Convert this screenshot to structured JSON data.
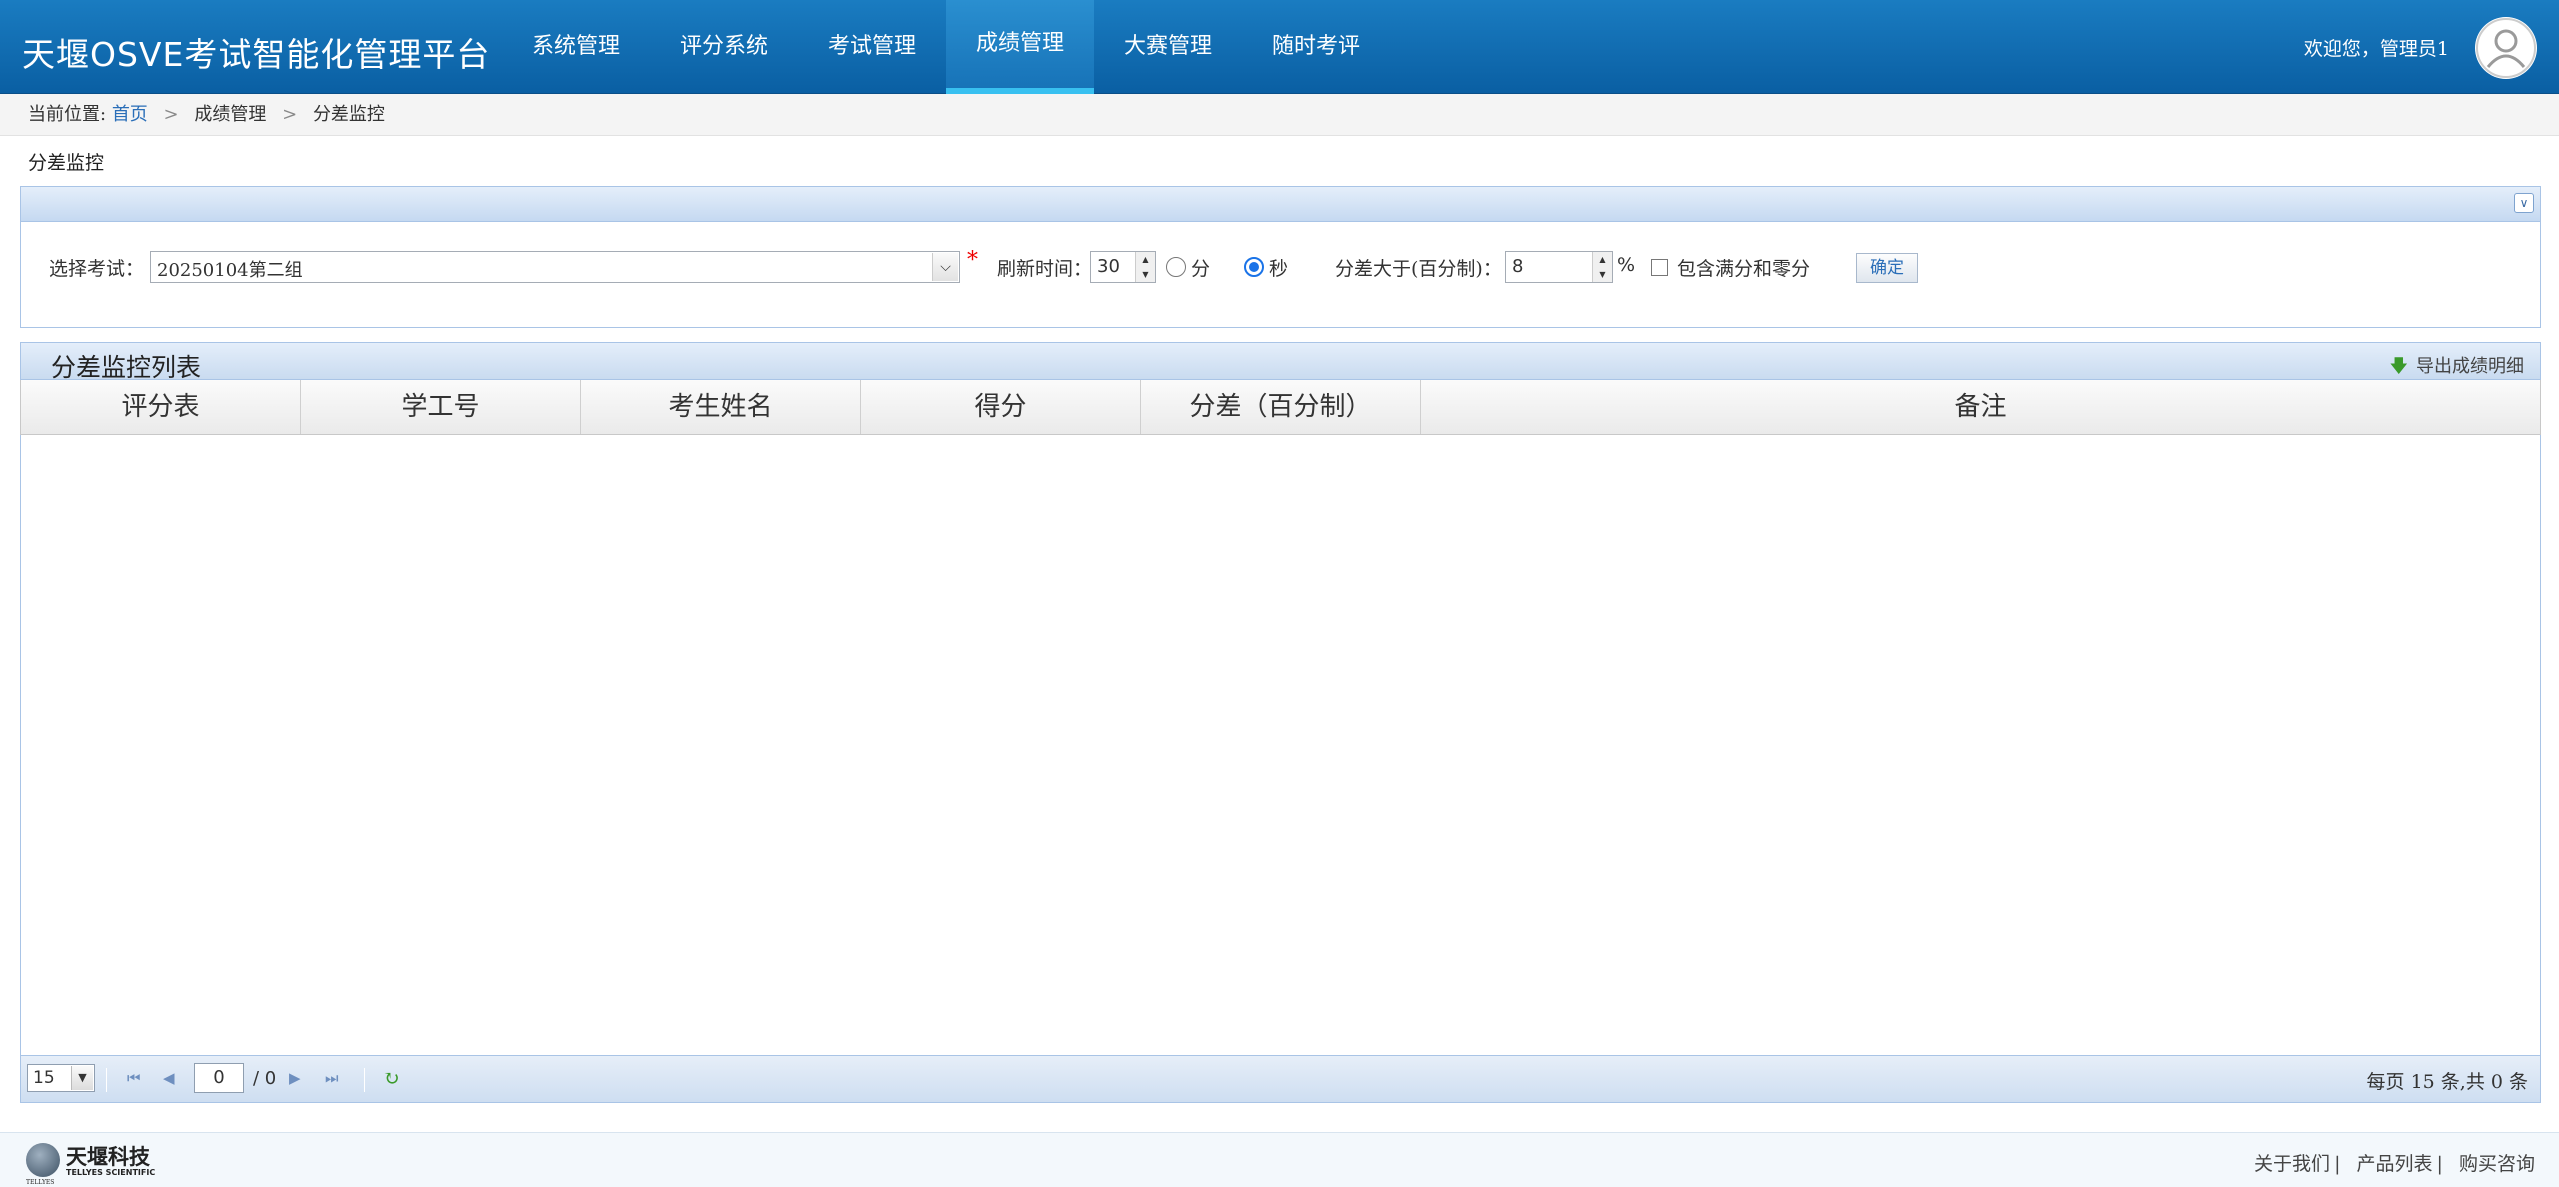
{
  "header": {
    "app_title": "天堰OSVE考试智能化管理平台",
    "nav": [
      "系统管理",
      "评分系统",
      "考试管理",
      "成绩管理",
      "大赛管理",
      "随时考评"
    ],
    "active_nav": "成绩管理",
    "welcome": "欢迎您，管理员1"
  },
  "breadcrumb": {
    "prefix": "当前位置:",
    "home": "首页",
    "sep": ">",
    "level1": "成绩管理",
    "level2": "分差监控"
  },
  "page_title": "分差监控",
  "filter": {
    "exam_label": "选择考试：",
    "exam_value": "20250104第二组",
    "required_mark": "*",
    "refresh_label": "刷新时间：",
    "refresh_value": "30",
    "unit_minute": "分",
    "unit_second": "秒",
    "selected_unit": "秒",
    "diff_label": "分差大于(百分制)：",
    "diff_value": "8",
    "percent": "%",
    "include_label": "包含满分和零分",
    "include_checked": false,
    "ok_button": "确定"
  },
  "list": {
    "title": "分差监控列表",
    "export_label": "导出成绩明细",
    "columns": [
      "评分表",
      "学工号",
      "考生姓名",
      "得分",
      "分差（百分制）",
      "备注"
    ],
    "rows": []
  },
  "pager": {
    "page_size": "15",
    "current_page": "0",
    "total_pages": "/ 0",
    "info": "每页 15 条,共 0 条"
  },
  "footer": {
    "logo_cn": "天堰科技",
    "logo_en": "TELLYES SCIENTIFIC",
    "logo_small": "TELLYES",
    "links": [
      "关于我们",
      "产品列表",
      "购买咨询"
    ],
    "separator": "|"
  }
}
